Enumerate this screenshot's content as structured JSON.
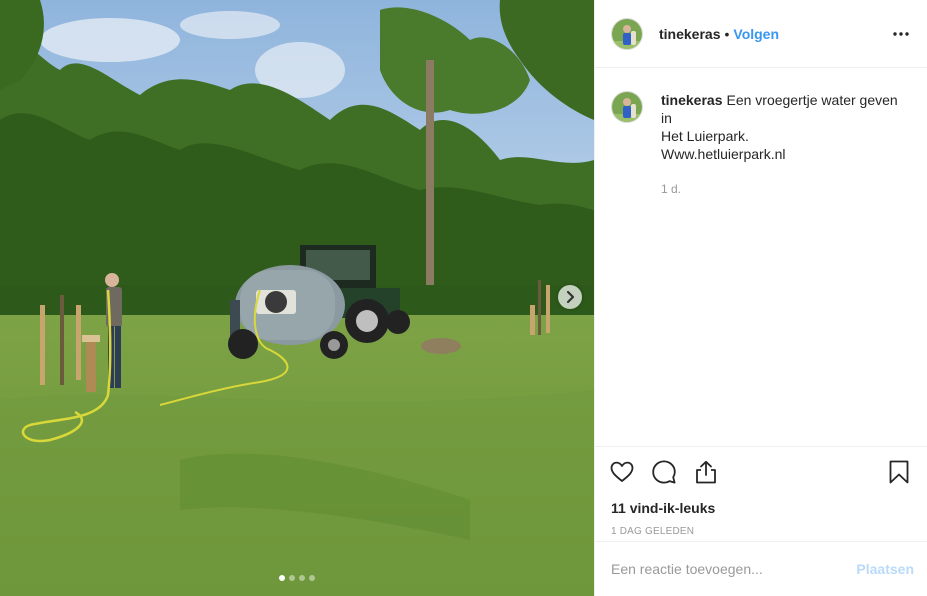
{
  "post": {
    "username": "tinekeras",
    "separator": "•",
    "follow_label": "Volgen",
    "caption": {
      "username": "tinekeras",
      "lines": [
        "Een vroegertje water geven in",
        "Het Luierpark.",
        "Www.hetluierpark.nl"
      ]
    },
    "time_ago": "1 d.",
    "likes": "11 vind-ik-leuks",
    "date": "1 DAG GELEDEN",
    "comment": {
      "placeholder": "Een reactie toevoegen...",
      "value": "",
      "post_label": "Plaatsen"
    }
  },
  "carousel": {
    "current_index": 1,
    "total": 4
  },
  "icons": {
    "more": "more-dots-icon",
    "like": "heart-icon",
    "comment": "comment-bubble-icon",
    "share": "share-icon",
    "save": "bookmark-icon",
    "next": "chevron-right-icon"
  },
  "colors": {
    "accent": "#3897f0",
    "text": "#262626",
    "muted": "#999999",
    "border": "#efefef"
  }
}
